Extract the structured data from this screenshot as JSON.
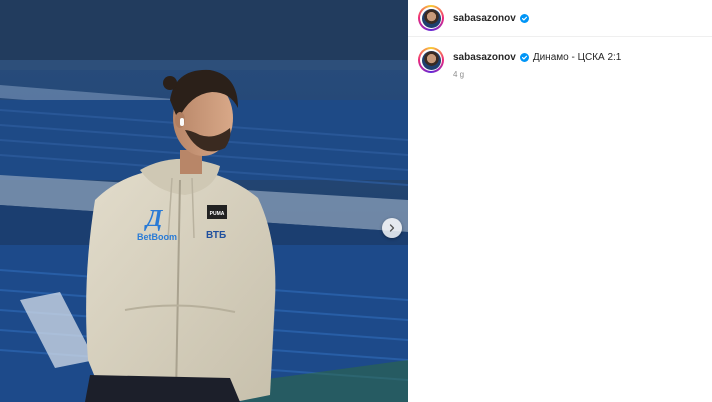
{
  "post": {
    "username": "sabasazonov",
    "verified": true,
    "caption": "Динамо - ЦСКА 2:1",
    "time_ago": "4 g",
    "media": {
      "sponsor_chest": "BetBoom",
      "brand_patch": "PUMA",
      "sponsor_right": "ВТБ"
    }
  },
  "colors": {
    "verified_blue": "#0095f6",
    "seat_blue": "#1e4a86",
    "hoodie": "#d9d3c1"
  },
  "icons": {
    "next": "chevron-right-icon",
    "verified": "verified-badge-icon"
  }
}
